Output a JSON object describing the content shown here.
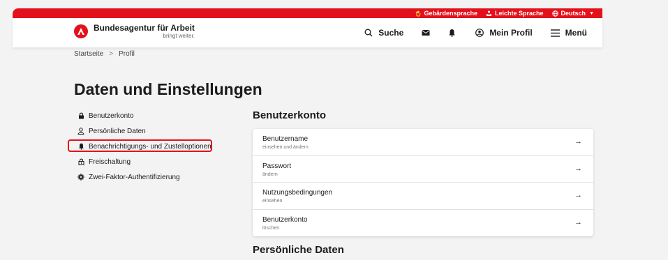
{
  "utility_bar": {
    "sign_language": "Gebärdensprache",
    "easy_language": "Leichte Sprache",
    "language": "Deutsch"
  },
  "header": {
    "brand_title": "Bundesagentur für Arbeit",
    "brand_tagline": "bringt weiter.",
    "search_label": "Suche",
    "profile_label": "Mein Profil",
    "menu_label": "Menü"
  },
  "breadcrumb": {
    "home": "Startseite",
    "separator": ">",
    "current": "Profil"
  },
  "page_title": "Daten und Einstellungen",
  "sidenav": {
    "items": [
      {
        "label": "Benutzerkonto",
        "icon": "lock-icon"
      },
      {
        "label": "Persönliche Daten",
        "icon": "person-icon"
      },
      {
        "label": "Benachrichtigungs- und Zustelloptionen",
        "icon": "bell-icon",
        "highlighted": true
      },
      {
        "label": "Freischaltung",
        "icon": "unlock-icon"
      },
      {
        "label": "Zwei-Faktor-Authentifizierung",
        "icon": "gear-icon"
      }
    ]
  },
  "section_account": {
    "title": "Benutzerkonto",
    "rows": [
      {
        "title": "Benutzername",
        "subtitle": "einsehen und ändern",
        "arrow": "→"
      },
      {
        "title": "Passwort",
        "subtitle": "ändern",
        "arrow": "→"
      },
      {
        "title": "Nutzungsbedingungen",
        "subtitle": "einsehen",
        "arrow": "→"
      },
      {
        "title": "Benutzerkonto",
        "subtitle": "löschen",
        "arrow": "→"
      }
    ]
  },
  "section_personal": {
    "title": "Persönliche Daten"
  },
  "colors": {
    "brand_red": "#e3111b",
    "page_bg": "#f3f3f3",
    "card_bg": "#ffffff"
  }
}
